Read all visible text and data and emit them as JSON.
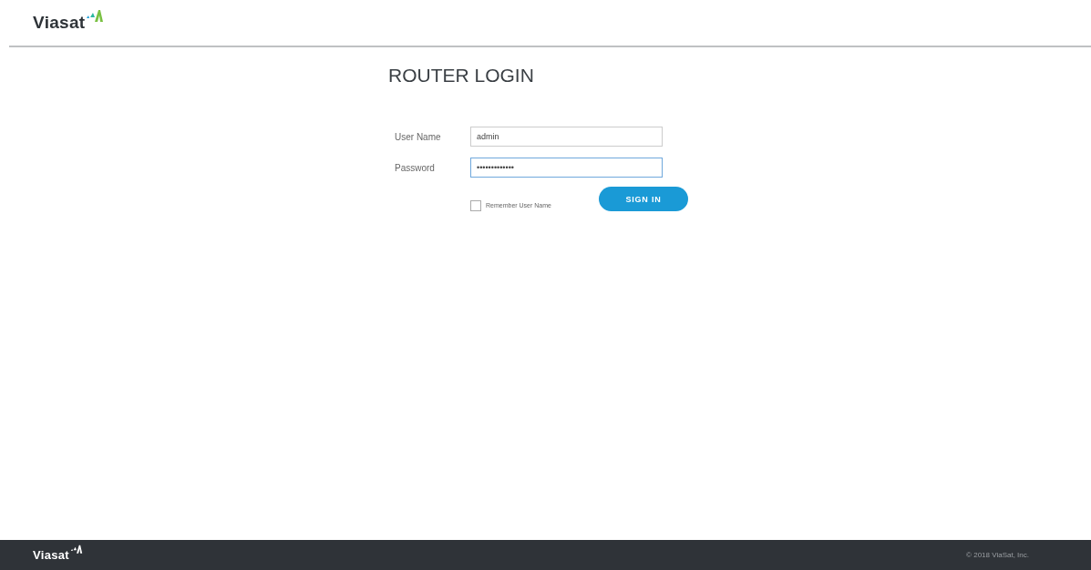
{
  "header": {
    "logo": "Viasat"
  },
  "login": {
    "title": "ROUTER LOGIN",
    "fields": [
      {
        "label": "User Name",
        "value": "admin",
        "focused": false
      },
      {
        "label": "Password",
        "value": "•••••••••••••",
        "focused": true
      }
    ],
    "remember": {
      "label": "Remember User Name",
      "checked": false
    },
    "button": "SIGN IN"
  },
  "footer": {
    "logo": "Viasat",
    "copyright": "© 2018 ViaSat, Inc."
  }
}
